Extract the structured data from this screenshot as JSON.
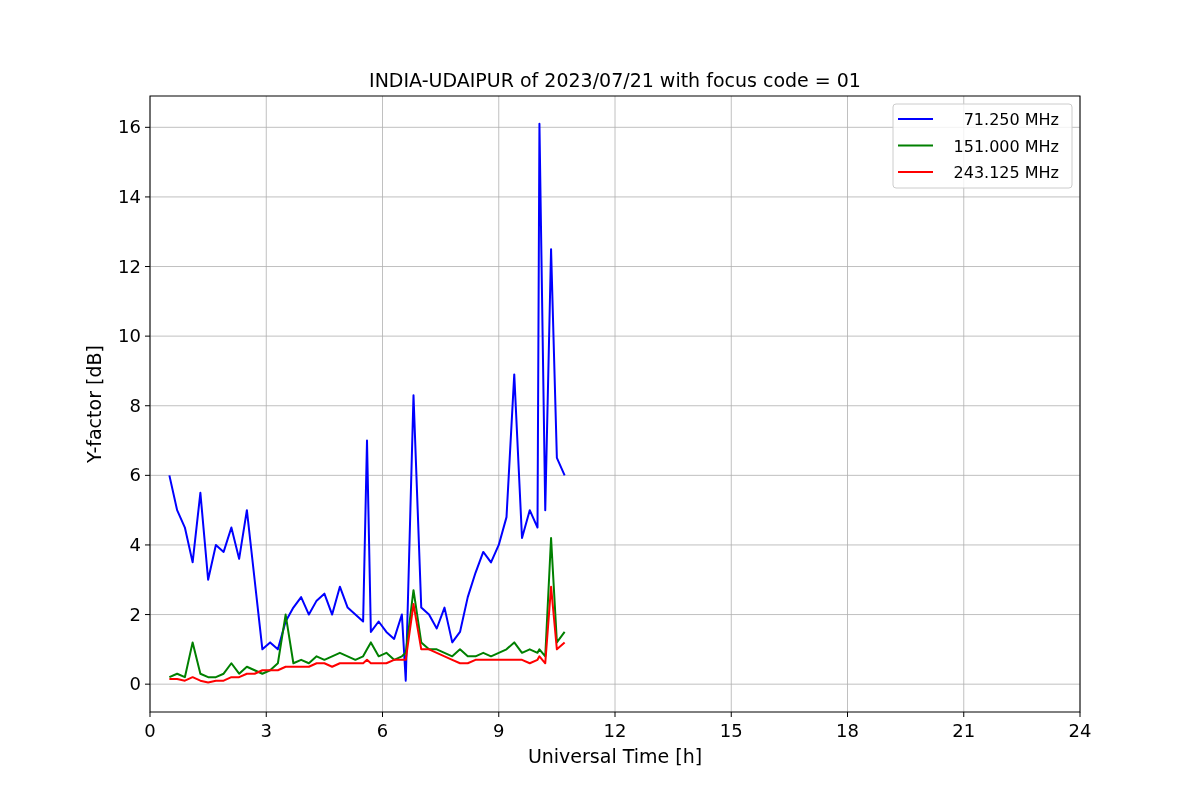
{
  "figure": {
    "chart_data": {
      "type": "line",
      "title": "INDIA-UDAIPUR of 2023/07/21 with focus code = 01",
      "xlabel": "Universal Time [h]",
      "ylabel": "Y-factor [dB]",
      "x": [
        0.5,
        0.7,
        0.9,
        1.1,
        1.3,
        1.5,
        1.7,
        1.9,
        2.1,
        2.3,
        2.5,
        2.7,
        2.9,
        3.1,
        3.3,
        3.5,
        3.7,
        3.9,
        4.1,
        4.3,
        4.5,
        4.7,
        4.9,
        5.1,
        5.3,
        5.5,
        5.6,
        5.7,
        5.9,
        6.1,
        6.3,
        6.5,
        6.6,
        6.8,
        7.0,
        7.2,
        7.4,
        7.6,
        7.8,
        8.0,
        8.2,
        8.4,
        8.6,
        8.8,
        9.0,
        9.2,
        9.4,
        9.6,
        9.8,
        10.0,
        10.05,
        10.2,
        10.35,
        10.5,
        10.7
      ],
      "series": [
        {
          "name": "71.250 MHz",
          "color": "#0000ff",
          "values": [
            6.0,
            5.0,
            4.5,
            3.5,
            5.5,
            3.0,
            4.0,
            3.8,
            4.5,
            3.6,
            5.0,
            3.0,
            1.0,
            1.2,
            1.0,
            1.8,
            2.2,
            2.5,
            2.0,
            2.4,
            2.6,
            2.0,
            2.8,
            2.2,
            2.0,
            1.8,
            7.0,
            1.5,
            1.8,
            1.5,
            1.3,
            2.0,
            0.1,
            8.3,
            2.2,
            2.0,
            1.6,
            2.2,
            1.2,
            1.5,
            2.5,
            3.2,
            3.8,
            3.5,
            4.0,
            4.8,
            8.9,
            4.2,
            5.0,
            4.5,
            16.1,
            5.0,
            12.5,
            6.5,
            6.0
          ]
        },
        {
          "name": "151.000 MHz",
          "color": "#008000",
          "values": [
            0.2,
            0.3,
            0.2,
            1.2,
            0.3,
            0.2,
            0.2,
            0.3,
            0.6,
            0.3,
            0.5,
            0.4,
            0.3,
            0.4,
            0.6,
            2.0,
            0.6,
            0.7,
            0.6,
            0.8,
            0.7,
            0.8,
            0.9,
            0.8,
            0.7,
            0.8,
            1.0,
            1.2,
            0.8,
            0.9,
            0.7,
            0.8,
            0.9,
            2.7,
            1.2,
            1.0,
            1.0,
            0.9,
            0.8,
            1.0,
            0.8,
            0.8,
            0.9,
            0.8,
            0.9,
            1.0,
            1.2,
            0.9,
            1.0,
            0.9,
            1.0,
            0.8,
            4.2,
            1.2,
            1.5
          ]
        },
        {
          "name": "243.125 MHz",
          "color": "#ff0000",
          "values": [
            0.15,
            0.15,
            0.1,
            0.2,
            0.1,
            0.05,
            0.1,
            0.1,
            0.2,
            0.2,
            0.3,
            0.3,
            0.4,
            0.4,
            0.4,
            0.5,
            0.5,
            0.5,
            0.5,
            0.6,
            0.6,
            0.5,
            0.6,
            0.6,
            0.6,
            0.6,
            0.7,
            0.6,
            0.6,
            0.6,
            0.7,
            0.7,
            0.7,
            2.3,
            1.0,
            1.0,
            0.9,
            0.8,
            0.7,
            0.6,
            0.6,
            0.7,
            0.7,
            0.7,
            0.7,
            0.7,
            0.7,
            0.7,
            0.6,
            0.7,
            0.8,
            0.6,
            2.8,
            1.0,
            1.2
          ]
        }
      ],
      "grid": true,
      "legend": true,
      "xlim": [
        0,
        24
      ],
      "ylim": [
        -0.8,
        16.9
      ],
      "xticks": [
        0,
        3,
        6,
        9,
        12,
        15,
        18,
        21,
        24
      ],
      "yticks": [
        0,
        2,
        4,
        6,
        8,
        10,
        12,
        14,
        16
      ]
    }
  }
}
